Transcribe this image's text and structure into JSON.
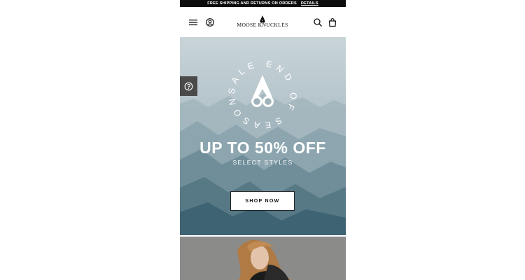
{
  "promo": {
    "text": "FREE SHIPPING AND RETURNS ON ORDERS",
    "link_label": "DETAILS"
  },
  "header": {
    "brand": "MOOSE KNUCKLES",
    "left_icons": [
      "menu-icon",
      "account-icon"
    ],
    "right_icons": [
      "search-icon",
      "bag-icon"
    ]
  },
  "hero": {
    "badge_text": "SALE END OF SEASON",
    "headline": "UP TO 50% OFF",
    "subheadline": "SELECT STYLES",
    "cta_label": "SHOP NOW",
    "help_icon": "question-icon"
  },
  "colors": {
    "promo_bg": "#0d0d0d",
    "help_tab_bg": "#4a4a4a",
    "hero_sky_top": "#c9d4d8",
    "hero_mountain_bottom": "#3e6373"
  }
}
